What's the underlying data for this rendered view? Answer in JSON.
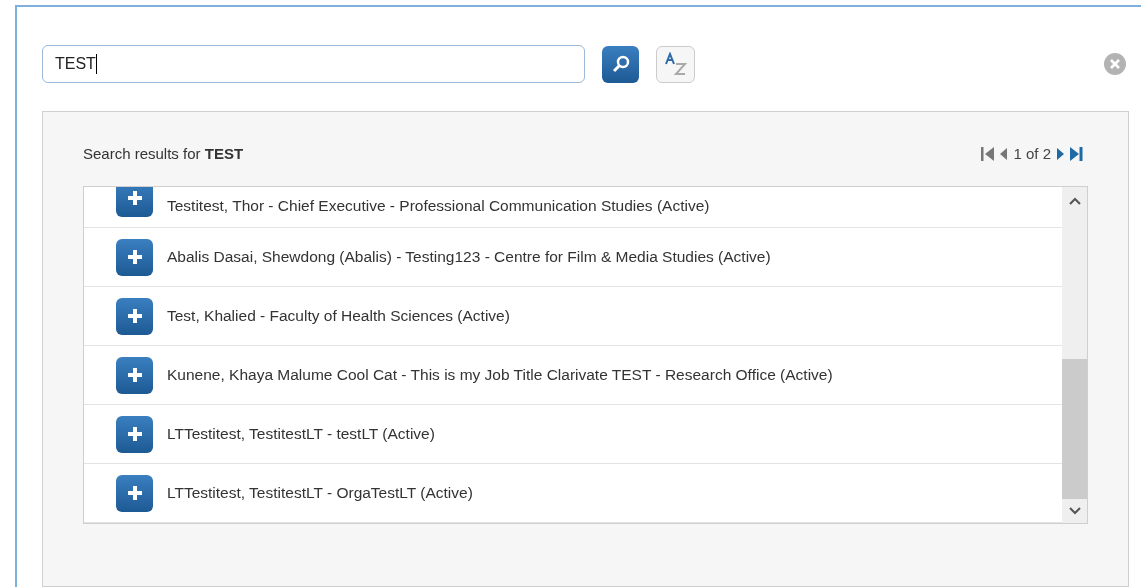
{
  "search": {
    "value": "TEST"
  },
  "results": {
    "label": "Search results for **TEST**",
    "pager": "1 of 2",
    "rows": [
      {
        "text": "Testitest, Thor - Chief Executive - Professional Communication Studies (Active)"
      },
      {
        "text": "Abalis Dasai, Shewdong (Abalis) - Testing123 - Centre for Film & Media Studies (Active)"
      },
      {
        "text": "Test, Khalied - Faculty of Health Sciences (Active)"
      },
      {
        "text": "Kunene, Khaya Malume Cool Cat - This is my Job Title Clarivate TEST - Research Office (Active)"
      },
      {
        "text": "LTTestitest, TestitestLT - testLT (Active)"
      },
      {
        "text": "LTTestitest, TestitestLT - OrgaTestLT (Active)"
      }
    ]
  }
}
